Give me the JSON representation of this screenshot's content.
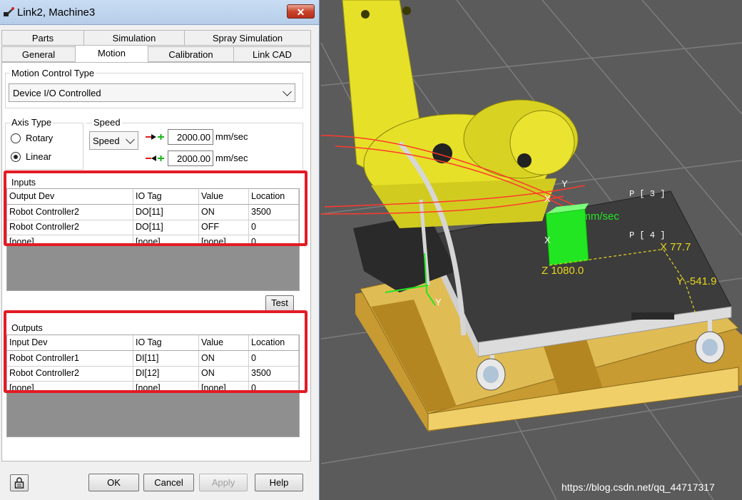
{
  "window": {
    "title": "Link2, Machine3",
    "close_label": "✕"
  },
  "tabs_row1": [
    "Parts",
    "Simulation",
    "Spray Simulation"
  ],
  "tabs_row2": [
    "General",
    "Motion",
    "Calibration",
    "Link CAD"
  ],
  "active_tab": "Motion",
  "motion_control": {
    "label": "Motion Control Type",
    "value": "Device I/O Controlled"
  },
  "axis_type": {
    "label": "Axis Type",
    "options": [
      "Rotary",
      "Linear"
    ],
    "selected": "Linear"
  },
  "speed": {
    "label": "Speed",
    "mode": "Speed",
    "forward_value": "2000.00",
    "reverse_value": "2000.00",
    "unit": "mm/sec"
  },
  "inputs": {
    "label": "Inputs",
    "columns": [
      "Output Dev",
      "IO Tag",
      "Value",
      "Location"
    ],
    "rows": [
      [
        "Robot Controller2",
        "DO[11]",
        "ON",
        "3500"
      ],
      [
        "Robot Controller2",
        "DO[11]",
        "OFF",
        "0"
      ],
      [
        "[none]",
        "[none]",
        "[none]",
        "0"
      ]
    ]
  },
  "test_label": "Test",
  "outputs": {
    "label": "Outputs",
    "columns": [
      "Input Dev",
      "IO Tag",
      "Value",
      "Location"
    ],
    "rows": [
      [
        "Robot Controller1",
        "DI[11]",
        "ON",
        "0"
      ],
      [
        "Robot Controller2",
        "DI[12]",
        "ON",
        "3500"
      ],
      [
        "[none]",
        "[none]",
        "[none]",
        "0"
      ]
    ]
  },
  "buttons": {
    "ok": "OK",
    "cancel": "Cancel",
    "apply": "Apply",
    "help": "Help"
  },
  "scene": {
    "speed_label": "2000mm/sec",
    "point_labels": [
      "P [ 3 ]",
      "P [ 4 ]"
    ],
    "axis_readouts": [
      "X 77.7",
      "Y -541.9",
      "Z 1080.0"
    ],
    "axis_letters": [
      "X",
      "Y",
      "X",
      "Y"
    ],
    "watermark": "https://blog.csdn.net/qq_44717317"
  },
  "colors": {
    "highlight_box": "#e21b24",
    "robot_yellow": "#e6e028",
    "floor": "#5a5a5a",
    "pallet": "#d9b24a",
    "part_green": "#22e622",
    "readout_yellow": "#e6d61e"
  }
}
